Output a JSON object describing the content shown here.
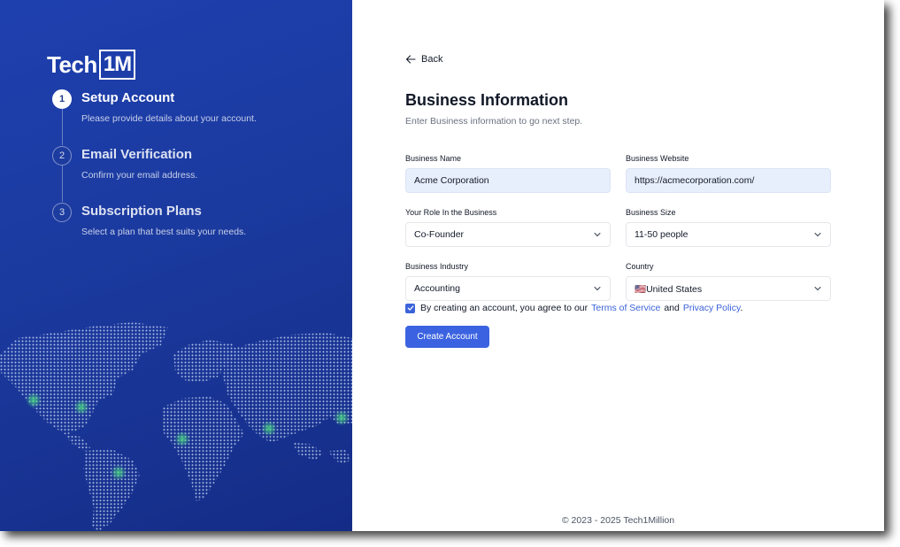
{
  "brand": {
    "text": "Tech",
    "box": "1M"
  },
  "steps": [
    {
      "number": "1",
      "title": "Setup Account",
      "desc": "Please provide details about your account."
    },
    {
      "number": "2",
      "title": "Email Verification",
      "desc": "Confirm your email address."
    },
    {
      "number": "3",
      "title": "Subscription Plans",
      "desc": "Select a plan that best suits your needs."
    }
  ],
  "active_step": 1,
  "back_label": "Back",
  "form": {
    "title": "Business Information",
    "subtitle": "Enter Business information to go next step.",
    "business_name": {
      "label": "Business Name",
      "value": "Acme Corporation"
    },
    "business_website": {
      "label": "Business Website",
      "value": "https://acmecorporation.com/"
    },
    "role": {
      "label": "Your Role In the Business",
      "value": "Co-Founder"
    },
    "size": {
      "label": "Business Size",
      "value": "11-50 people"
    },
    "industry": {
      "label": "Business Industry",
      "value": "Accounting"
    },
    "country": {
      "label": "Country",
      "value": "🇺🇸United States"
    }
  },
  "agreement": {
    "checked": true,
    "prefix": "By creating an account, you agree to our",
    "terms": "Terms of Service",
    "and": "and",
    "privacy": "Privacy Policy",
    "suffix": "."
  },
  "submit_label": "Create Account",
  "footer": "© 2023 - 2025 Tech1Million",
  "colors": {
    "panel": "#1e40af",
    "accent": "#3b63e1",
    "filled_input": "#e8effc"
  }
}
